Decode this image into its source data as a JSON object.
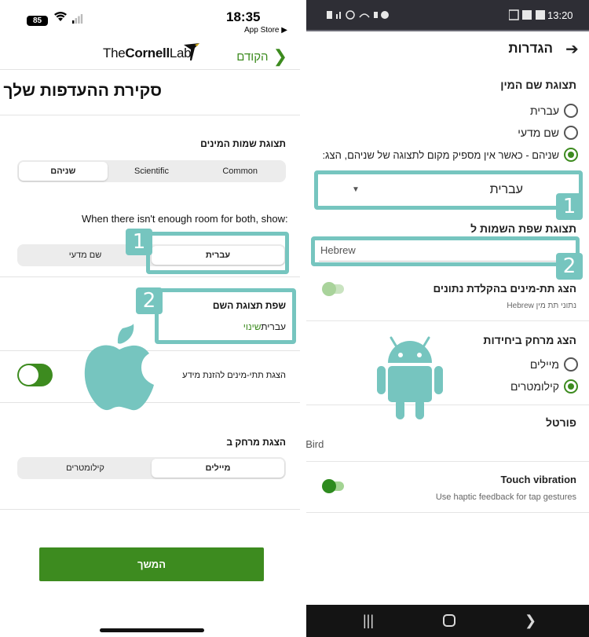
{
  "ios": {
    "status": {
      "time": "18:35",
      "back_app": "App Store ▶",
      "battery": "85"
    },
    "header": {
      "logo_prefix": "The",
      "logo_bold": "Cornell",
      "logo_suffix": "Lab",
      "back_label": "הקודם"
    },
    "title": "סקירת ההעדפות שלך",
    "species_display": {
      "label": "תצוגת שמות המינים",
      "options": [
        "Common",
        "Scientific",
        "שניהם"
      ],
      "selected": "שניהם"
    },
    "fallback": {
      "text": "When there isn't enough room for both, show:",
      "options": [
        "שם מדעי",
        "עברית"
      ],
      "selected": "עברית"
    },
    "name_language": {
      "label": "שפת תצוגת השם",
      "value": "עברית",
      "change_link": "שינוי"
    },
    "subspecies": {
      "label": "הצגת תתי-מינים להזנת מידע",
      "enabled": true
    },
    "distance": {
      "label": "הצגת מרחק ב",
      "options": [
        "קילומטרים",
        "מיילים"
      ],
      "selected": "מיילים"
    },
    "continue_button": "המשך"
  },
  "android": {
    "status": {
      "time": "13:20"
    },
    "title": "הגדרות",
    "species_display": {
      "label": "תצוגת שם המין",
      "options": [
        "עברית",
        "שם מדעי",
        "שניהם - כאשר אין מספיק מקום לתצוגה של שניהם, הצג:"
      ],
      "selected_index": 2
    },
    "dropdown_value": "עברית",
    "name_language": {
      "label": "תצוגת שפת השמות ל",
      "value": "Hebrew"
    },
    "subspecies": {
      "label": "הצג תת-מינים בהקלדת נתונים",
      "sub": "נתוני תת מין Hebrew",
      "enabled": false
    },
    "distance": {
      "label": "הצג מרחק ביחידות",
      "options": [
        "מיילים",
        "קילומטרים"
      ],
      "selected_index": 1
    },
    "portal": {
      "label": "פורטל",
      "value": "eBird"
    },
    "touch_vibration": {
      "label": "Touch vibration",
      "sub": "Use haptic feedback for tap gestures",
      "enabled": true
    }
  },
  "annotations": {
    "badge_1": "1",
    "badge_2": "2"
  },
  "colors": {
    "accent_green": "#3d8b1f",
    "highlight_teal": "#76c5bf"
  }
}
